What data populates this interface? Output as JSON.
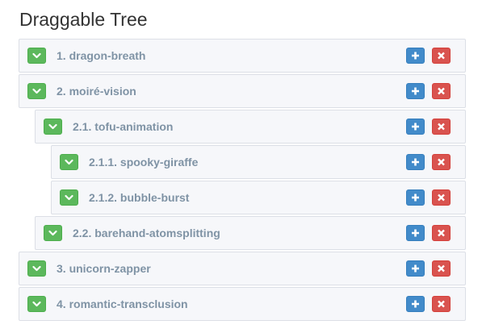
{
  "page": {
    "title": "Draggable Tree"
  },
  "colors": {
    "toggle": "#5cb85c",
    "add": "#428bca",
    "remove": "#d9534f",
    "node_bg": "#f6f7fa",
    "node_border": "#dcdfe6",
    "label": "#7f93a5"
  },
  "icons": {
    "toggle": "chevron-down-icon",
    "add": "plus-icon",
    "remove": "close-icon"
  },
  "tree": {
    "nodes": [
      {
        "label": "1. dragon-breath",
        "depth": 0
      },
      {
        "label": "2. moiré-vision",
        "depth": 0
      },
      {
        "label": "2.1. tofu-animation",
        "depth": 1
      },
      {
        "label": "2.1.1. spooky-giraffe",
        "depth": 2
      },
      {
        "label": "2.1.2. bubble-burst",
        "depth": 2
      },
      {
        "label": "2.2. barehand-atomsplitting",
        "depth": 1
      },
      {
        "label": "3. unicorn-zapper",
        "depth": 0
      },
      {
        "label": "4. romantic-transclusion",
        "depth": 0
      }
    ]
  }
}
